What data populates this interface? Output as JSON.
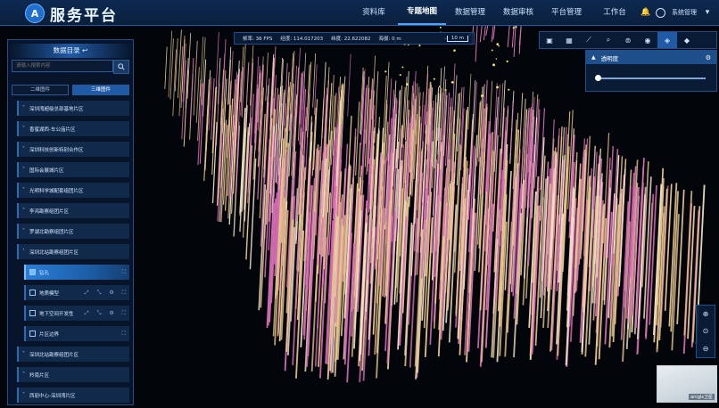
{
  "app": {
    "brand": "服务平台",
    "logo_glyph": "A"
  },
  "nav": {
    "items": [
      "资料库",
      "专题地图",
      "数据管理",
      "数据审核",
      "平台管理",
      "工作台"
    ],
    "active_index": 1
  },
  "user": {
    "name": "系统管理"
  },
  "statusbar": {
    "fps": "帧率: 36 FPS",
    "lon": "经度: 114.017203",
    "lat": "纬度: 22.622082",
    "alt": "海拔: 0 m",
    "scale": "10 m"
  },
  "panel": {
    "title": "数据目录 ↩",
    "search_placeholder": "请输入搜索内容",
    "tabs": [
      "二维图件",
      "三维图件"
    ],
    "active_tab": 1,
    "items": [
      {
        "label": "深圳湾超级总部基地片区",
        "type": "group"
      },
      {
        "label": "香蜜湖西-车公庙片区",
        "type": "group"
      },
      {
        "label": "深圳科技创新特别合作区",
        "type": "group"
      },
      {
        "label": "国际会展城片区",
        "type": "group"
      },
      {
        "label": "光明科学城配套组团片区",
        "type": "group"
      },
      {
        "label": "李鸿勘察组团片区",
        "type": "group"
      },
      {
        "label": "罗湖北勘察组团片区",
        "type": "group"
      },
      {
        "label": "深圳北站勘察组团片区",
        "type": "group-open"
      },
      {
        "label": "钻孔",
        "type": "selected"
      },
      {
        "label": "地质模型",
        "type": "child"
      },
      {
        "label": "地下空间开发性",
        "type": "child"
      },
      {
        "label": "片区边界",
        "type": "child-simple"
      },
      {
        "label": "深圳北站勘察组团片区",
        "type": "group"
      },
      {
        "label": "羚南片区",
        "type": "group"
      },
      {
        "label": "西丽中心-深圳湾片区",
        "type": "group"
      }
    ]
  },
  "toolbar": {
    "tools": [
      "layers-icon",
      "grid-icon",
      "measure-icon",
      "search-icon",
      "location-icon",
      "eye-icon",
      "stack-icon",
      "layers-3d-icon"
    ],
    "active_index": 6
  },
  "opacity_panel": {
    "title": "透明度",
    "value": 0.0
  },
  "minimap": {
    "caption": "arcgis卫星"
  },
  "colors": {
    "accent": "#1f5aa6",
    "bg": "#02050a",
    "panel": "#081a34"
  }
}
